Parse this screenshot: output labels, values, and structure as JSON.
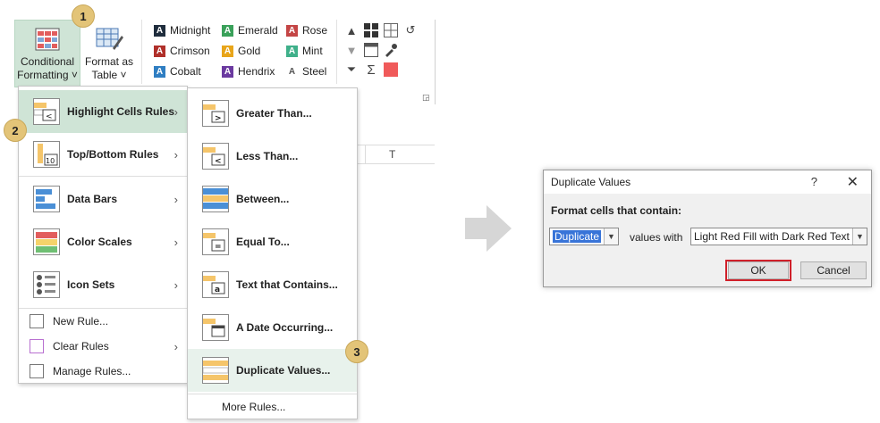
{
  "ribbon": {
    "conditional_formatting": [
      "Conditional",
      "Formatting ˅"
    ],
    "format_as_table": [
      "Format as",
      "Table ˅"
    ],
    "styles": [
      {
        "label": "Midnight",
        "letter": "A",
        "color": "#1f2d3d"
      },
      {
        "label": "Emerald",
        "letter": "A",
        "color": "#3aa15a"
      },
      {
        "label": "Rose",
        "letter": "A",
        "color": "#c44545"
      },
      {
        "label": "Crimson",
        "letter": "A",
        "color": "#b0302a"
      },
      {
        "label": "Gold",
        "letter": "A",
        "color": "#e8a51a"
      },
      {
        "label": "Mint",
        "letter": "A",
        "color": "#3fb08a"
      },
      {
        "label": "Cobalt",
        "letter": "A",
        "color": "#2f7ec2"
      },
      {
        "label": "Hendrix",
        "letter": "A",
        "color": "#6b3aa0"
      },
      {
        "label": "Steel",
        "letter": "A",
        "color": "#ffffff"
      }
    ],
    "column_letter": "T"
  },
  "menu": {
    "highlight_cells_rules": "Highlight Cells Rules",
    "top_bottom_rules": "Top/Bottom Rules",
    "data_bars": "Data Bars",
    "color_scales": "Color Scales",
    "icon_sets": "Icon Sets",
    "new_rule": "New Rule...",
    "clear_rules": "Clear Rules",
    "manage_rules": "Manage Rules...",
    "icon_top10_text": "10"
  },
  "submenu": {
    "greater_than": "Greater Than...",
    "less_than": "Less Than...",
    "between": "Between...",
    "equal_to": "Equal To...",
    "text_contains": "Text that Contains...",
    "date_occurring": "A Date Occurring...",
    "duplicate_values": "Duplicate Values...",
    "more_rules": "More Rules..."
  },
  "badges": [
    "1",
    "2",
    "3"
  ],
  "dialog": {
    "title": "Duplicate Values",
    "help": "?",
    "close": "✕",
    "heading": "Format cells that contain:",
    "type_value": "Duplicate",
    "values_with": "values with",
    "format_value": "Light Red Fill with Dark Red Text",
    "ok": "OK",
    "cancel": "Cancel"
  }
}
